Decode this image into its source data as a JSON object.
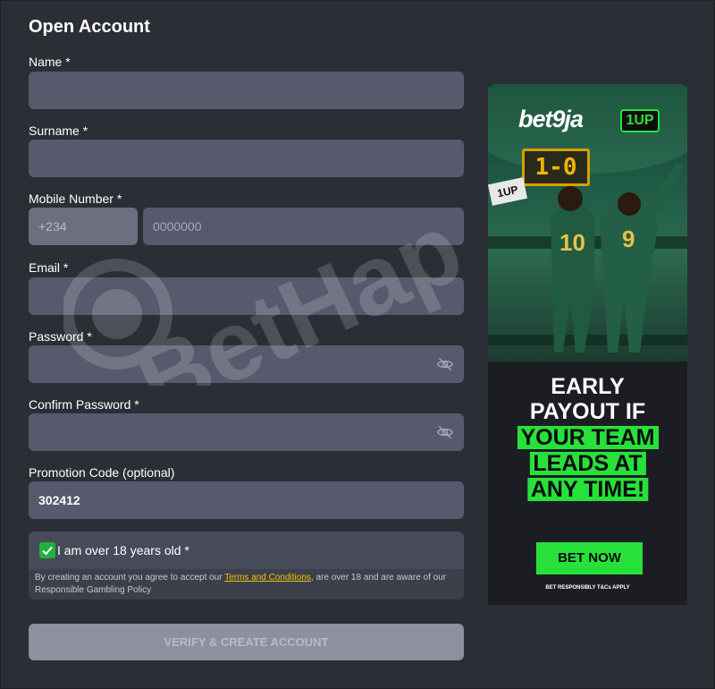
{
  "form": {
    "title": "Open Account",
    "name_label": "Name *",
    "surname_label": "Surname *",
    "mobile_label": "Mobile Number *",
    "mobile_prefix": "+234",
    "mobile_placeholder": "0000000",
    "email_label": "Email *",
    "password_label": "Password *",
    "confirm_password_label": "Confirm Password *",
    "promo_label": "Promotion Code (optional)",
    "promo_value": "302412",
    "age_checkbox_label": "I am over 18 years old *",
    "age_checked": true,
    "legal_prefix": "By creating an account you agree to accept our ",
    "legal_link": "Terms and Conditions",
    "legal_suffix": ", are over 18 and are aware of our Responsible Gambling Policy",
    "submit_label": "VERIFY & CREATE ACCOUNT"
  },
  "watermark": {
    "text": "BetHap"
  },
  "ad": {
    "logo": "bet9ja",
    "badge": "1UP",
    "score": "1-0",
    "flag": "1UP",
    "player_numbers": [
      "10",
      "9"
    ],
    "headline_line1": "EARLY",
    "headline_line2": "PAYOUT IF",
    "highlight_line1": "YOUR TEAM",
    "highlight_line2": "LEADS AT",
    "highlight_line3": "ANY TIME!",
    "cta": "BET NOW",
    "footer": "BET RESPONSIBLY   T&Cs APPLY"
  },
  "colors": {
    "background": "#2b2e35",
    "input": "#565a6c",
    "accent_green": "#27e13b",
    "checkbox_green": "#1fb141",
    "link_yellow": "#f2c200"
  },
  "icons": {
    "password_toggle": "eye-slash-icon",
    "checkbox": "checkmark-icon"
  }
}
